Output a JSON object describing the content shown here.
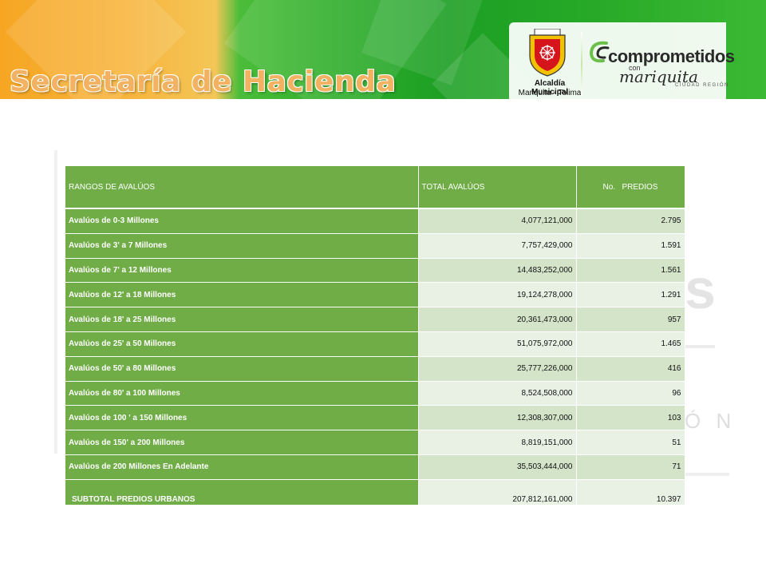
{
  "header": {
    "title": "Secretaría de Hacienda",
    "alcaldia_name": "Alcaldía Municipal",
    "alcaldia_place": "Mariquita - Tolima",
    "slogan_word1": "comprometidos",
    "slogan_con": "con",
    "slogan_word2": "mariquita",
    "slogan_tag": "CIUDAD REGIÓN"
  },
  "colors": {
    "header_green": "#70ad47",
    "row_odd": "#d3e4c9",
    "row_even": "#e9f1e5",
    "banner_orange": "#f6a623",
    "banner_green": "#2fae2b"
  },
  "table": {
    "headers": [
      "RANGOS DE AVALÚOS",
      "TOTAL AVALÚOS",
      "No.   PREDIOS"
    ],
    "rows": [
      {
        "range": "Avalúos de 0-3 Millones",
        "total": "4,077,121,000",
        "predios": "2.795"
      },
      {
        "range": "Avalúos de 3' a 7 Millones",
        "total": "7,757,429,000",
        "predios": "1.591"
      },
      {
        "range": "Avalúos de 7' a 12 Millones",
        "total": "14,483,252,000",
        "predios": "1.561"
      },
      {
        "range": "Avalúos de 12' a 18 Millones",
        "total": "19,124,278,000",
        "predios": "1.291"
      },
      {
        "range": "Avalúos de 18' a 25 Millones",
        "total": "20,361,473,000",
        "predios": "957"
      },
      {
        "range": "Avalúos de 25' a 50 Millones",
        "total": "51,075,972,000",
        "predios": "1.465"
      },
      {
        "range": "Avalúos de 50' a 80 Millones",
        "total": "25,777,226,000",
        "predios": "416"
      },
      {
        "range": "Avalúos de 80' a 100 Millones",
        "total": "8,524,508,000",
        "predios": "96"
      },
      {
        "range": "Avalúos de 100 ' a 150 Millones",
        "total": "12,308,307,000",
        "predios": "103"
      },
      {
        "range": "Avalúos de 150' a 200 Millones",
        "total": "8,819,151,000",
        "predios": "51"
      },
      {
        "range": "Avalúos de 200 Millones En Adelante",
        "total": "35,503,444,000",
        "predios": "71"
      }
    ],
    "subtotal": {
      "range": "SUBTOTAL PREDIOS URBANOS",
      "total": "207,812,161,000",
      "predios": "10.397"
    }
  }
}
